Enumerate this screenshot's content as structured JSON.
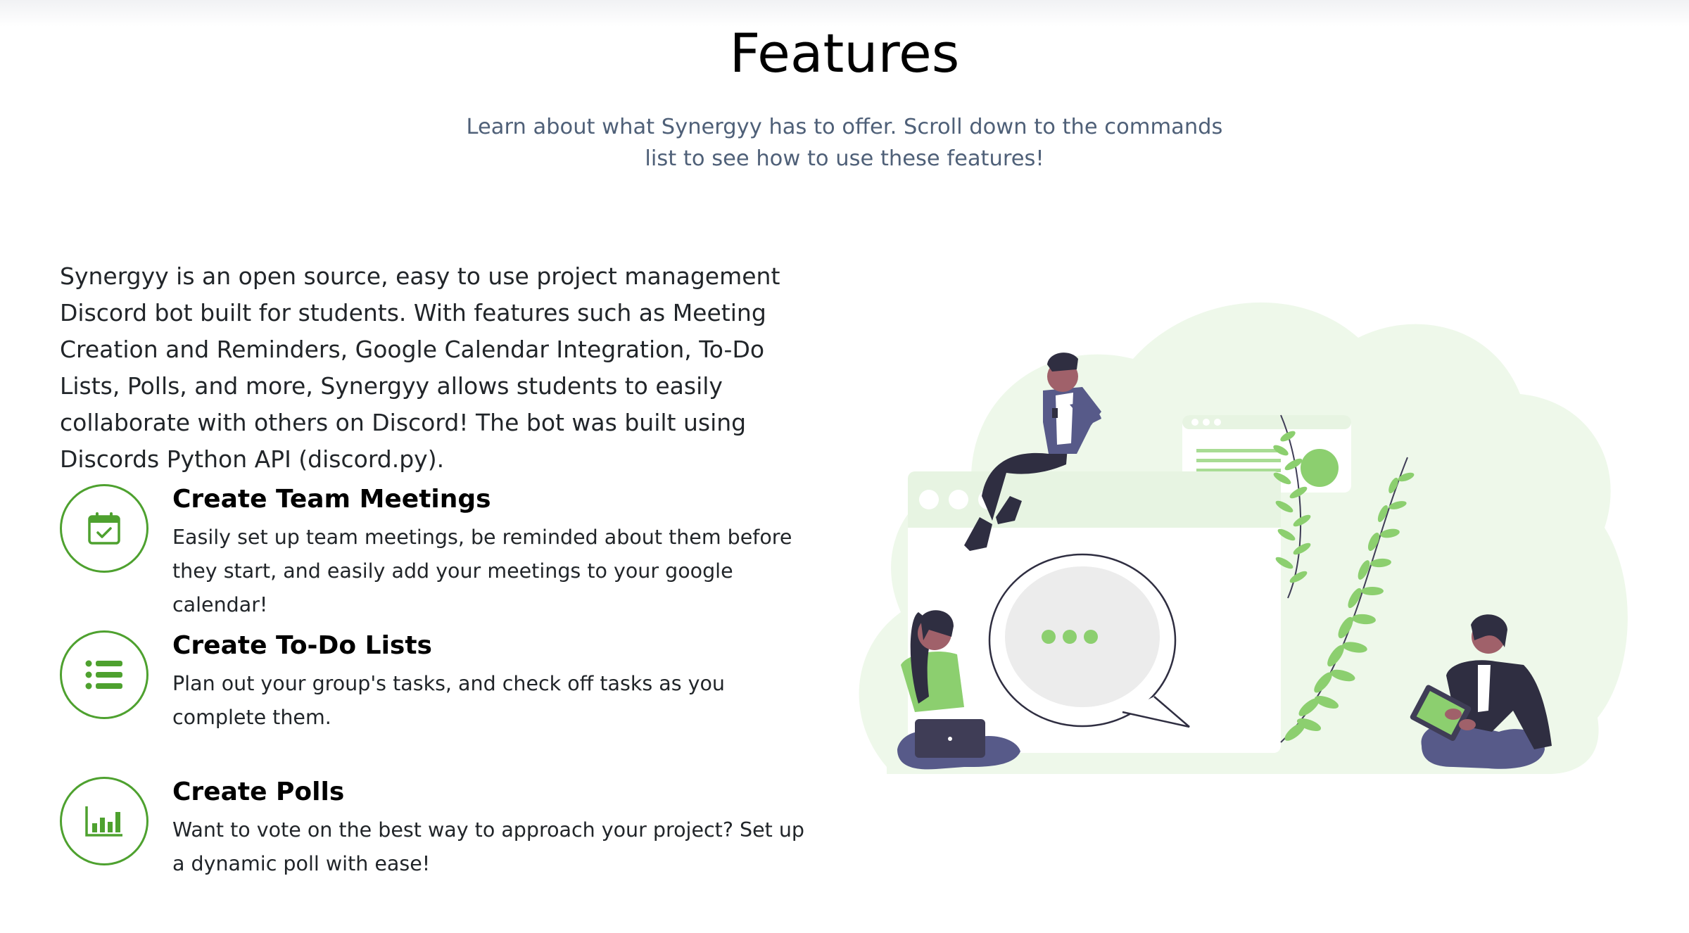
{
  "header": {
    "title": "Features",
    "subtitle": "Learn about what Synergyy has to offer. Scroll down to the commands list to see how to use these features!"
  },
  "intro": {
    "text": "Synergyy is an open source, easy to use project management Discord bot built for students. With features such as Meeting Creation and Reminders, Google Calendar Integration, To-Do Lists, Polls, and more, Synergyy allows students to easily collaborate with others on Discord! The bot was built using Discords Python API (discord.py)."
  },
  "features": [
    {
      "icon": "calendar-check-icon",
      "title": "Create Team Meetings",
      "description": "Easily set up team meetings, be reminded about them before they start, and easily add your meetings to your google calendar!"
    },
    {
      "icon": "list-icon",
      "title": "Create To-Do Lists",
      "description": "Plan out your group's tasks, and check off tasks as you complete them."
    },
    {
      "icon": "bar-chart-icon",
      "title": "Create Polls",
      "description": "Want to vote on the best way to approach your project? Set up a dynamic poll with ease!"
    }
  ],
  "colors": {
    "accent": "#4ea12f",
    "illustration_green": "#8ccf6f",
    "subtitle": "#4f6078"
  }
}
